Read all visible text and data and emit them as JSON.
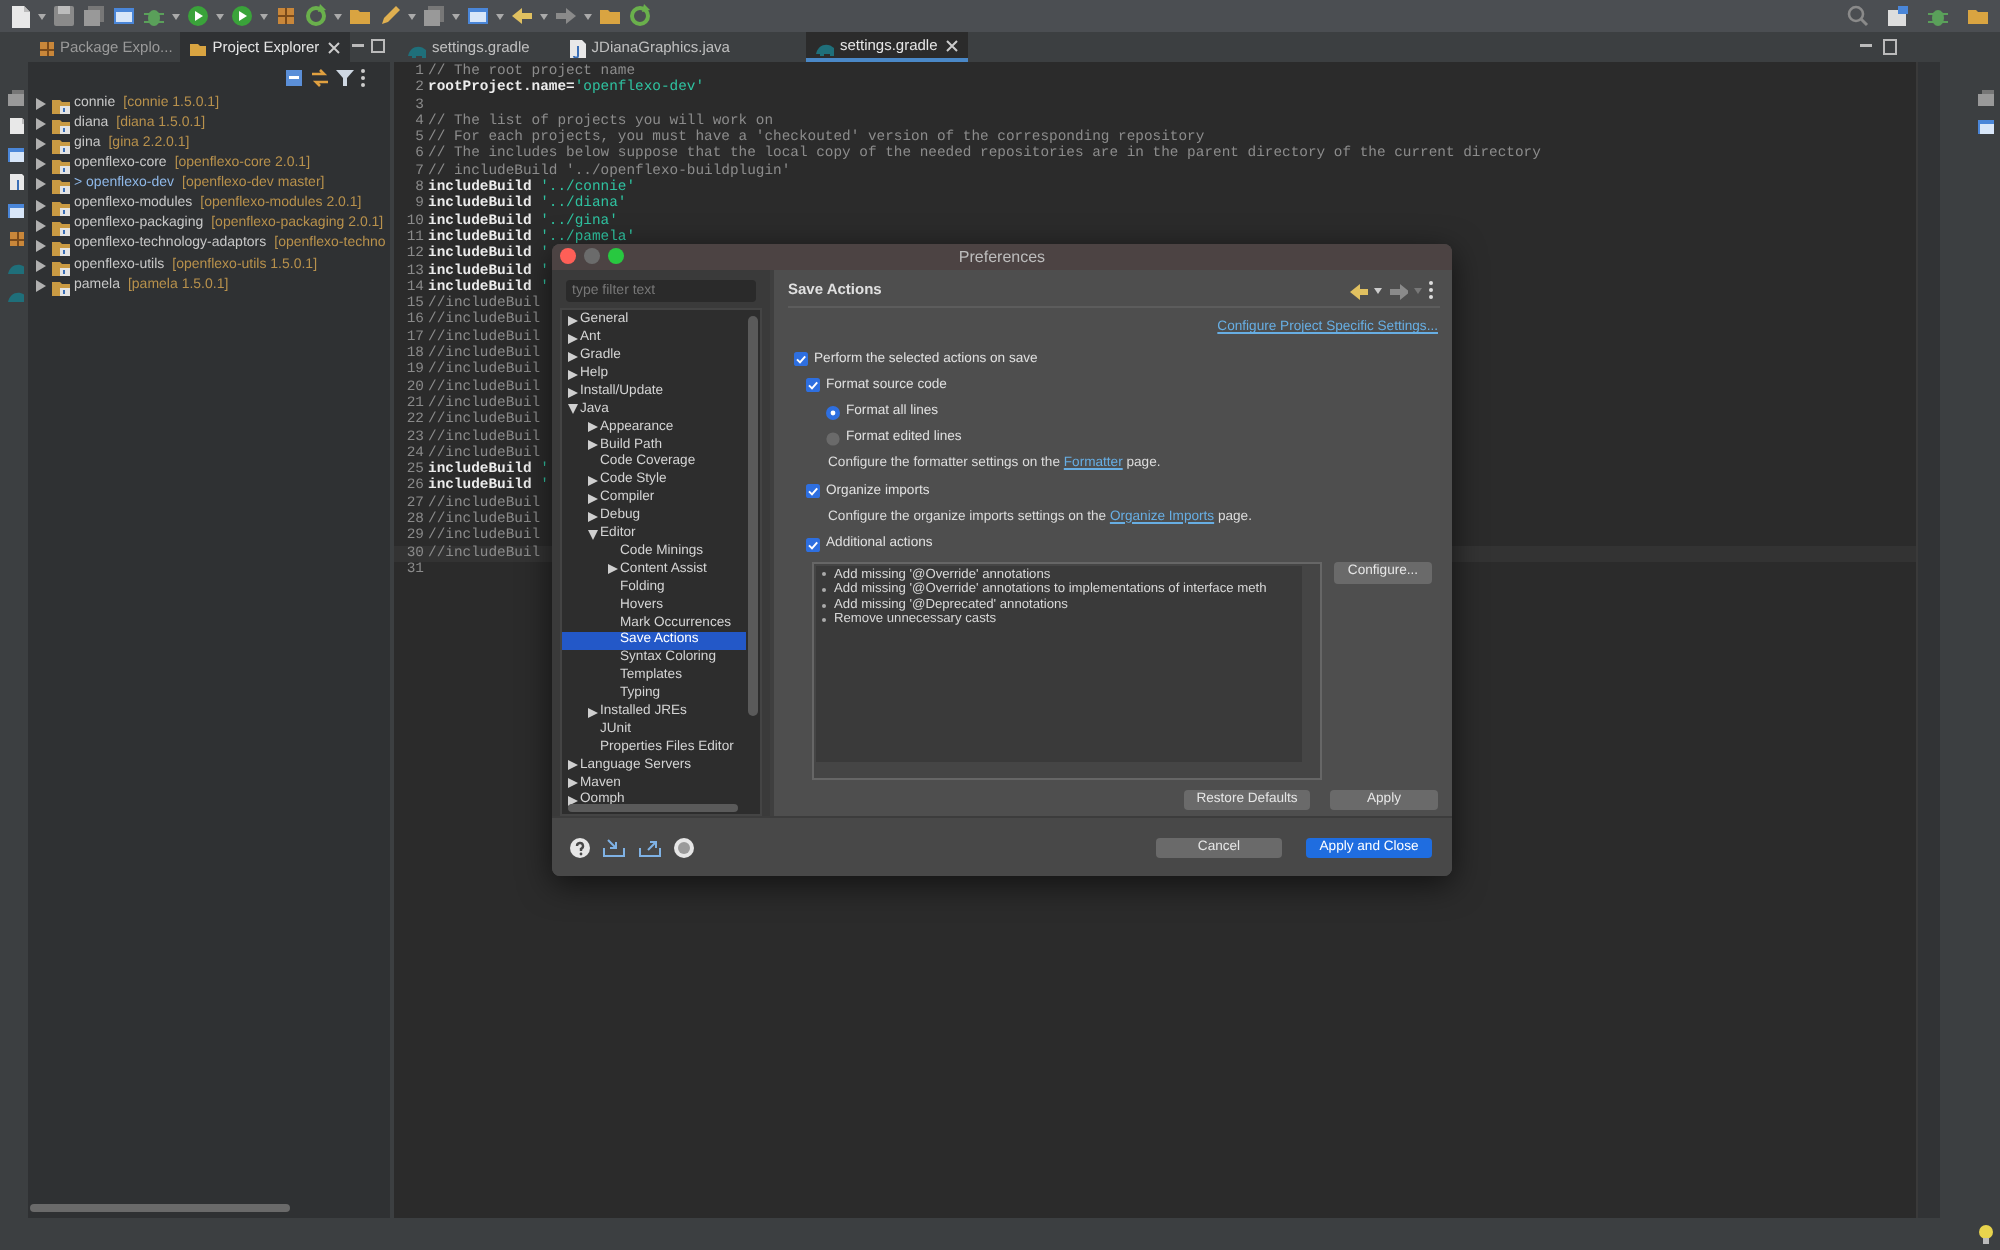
{
  "left_panel": {
    "tabs": [
      {
        "label": "Package Explo...",
        "selected": false
      },
      {
        "label": "Project Explorer",
        "selected": true
      }
    ],
    "projects": [
      {
        "name": "connie",
        "decoration": "[connie 1.5.0.1]",
        "dirty": false
      },
      {
        "name": "diana",
        "decoration": "[diana 1.5.0.1]",
        "dirty": false
      },
      {
        "name": "gina",
        "decoration": "[gina 2.2.0.1]",
        "dirty": false
      },
      {
        "name": "openflexo-core",
        "decoration": "[openflexo-core 2.0.1]",
        "dirty": false
      },
      {
        "prefix": "> ",
        "name": "openflexo-dev",
        "decoration": "[openflexo-dev master]",
        "dirty": true
      },
      {
        "name": "openflexo-modules",
        "decoration": "[openflexo-modules 2.0.1]",
        "dirty": false
      },
      {
        "name": "openflexo-packaging",
        "decoration": "[openflexo-packaging 2.0.1]",
        "dirty": false
      },
      {
        "name": "openflexo-technology-adaptors",
        "decoration": "[openflexo-techno",
        "dirty": false
      },
      {
        "name": "openflexo-utils",
        "decoration": "[openflexo-utils 1.5.0.1]",
        "dirty": false
      },
      {
        "name": "pamela",
        "decoration": "[pamela 1.5.0.1]",
        "dirty": false
      }
    ]
  },
  "editor": {
    "tabs": [
      {
        "label": "settings.gradle",
        "selected": false
      },
      {
        "label": "JDianaGraphics.java",
        "selected": false
      },
      {
        "label": "settings.gradle",
        "selected": true
      }
    ],
    "lines": [
      {
        "number": "1",
        "kind": "comment",
        "text": "// The root project name"
      },
      {
        "number": "2",
        "kind": "code",
        "code": "rootProject.name=",
        "string": "'openflexo-dev'"
      },
      {
        "number": "3",
        "kind": "blank"
      },
      {
        "number": "4",
        "kind": "comment",
        "text": "// The list of projects you will work on"
      },
      {
        "number": "5",
        "kind": "comment",
        "text": "// For each projects, you must have a 'checkouted' version of the corresponding repository"
      },
      {
        "number": "6",
        "kind": "comment",
        "text": "// The includes below suppose that the local copy of the needed repositories are in the parent directory of the current directory"
      },
      {
        "number": "7",
        "kind": "comment",
        "text": "// includeBuild '../openflexo-buildplugin'"
      },
      {
        "number": "8",
        "kind": "code",
        "code": "includeBuild ",
        "string": "'../connie'"
      },
      {
        "number": "9",
        "kind": "code",
        "code": "includeBuild ",
        "string": "'../diana'"
      },
      {
        "number": "10",
        "kind": "code",
        "code": "includeBuild ",
        "string": "'../gina'"
      },
      {
        "number": "11",
        "kind": "code",
        "code": "includeBuild ",
        "string": "'../pamela'"
      },
      {
        "number": "12",
        "kind": "code",
        "code": "includeBuild ",
        "string": "'"
      },
      {
        "number": "13",
        "kind": "code",
        "code": "includeBuild ",
        "string": "'"
      },
      {
        "number": "14",
        "kind": "code",
        "code": "includeBuild ",
        "string": "'"
      },
      {
        "number": "15",
        "kind": "comment",
        "text": "//includeBuil"
      },
      {
        "number": "16",
        "kind": "comment",
        "text": "//includeBuil"
      },
      {
        "number": "17",
        "kind": "comment",
        "text": "//includeBuil"
      },
      {
        "number": "18",
        "kind": "comment",
        "text": "//includeBuil"
      },
      {
        "number": "19",
        "kind": "comment",
        "text": "//includeBuil"
      },
      {
        "number": "20",
        "kind": "comment",
        "text": "//includeBuil"
      },
      {
        "number": "21",
        "kind": "comment",
        "text": "//includeBuil"
      },
      {
        "number": "22",
        "kind": "comment",
        "text": "//includeBuil"
      },
      {
        "number": "23",
        "kind": "comment",
        "text": "//includeBuil"
      },
      {
        "number": "24",
        "kind": "comment",
        "text": "//includeBuil"
      },
      {
        "number": "25",
        "kind": "code",
        "code": "includeBuild ",
        "string": "'"
      },
      {
        "number": "26",
        "kind": "code",
        "code": "includeBuild ",
        "string": "'"
      },
      {
        "number": "27",
        "kind": "comment",
        "text": "//includeBuil"
      },
      {
        "number": "28",
        "kind": "comment",
        "text": "//includeBuil"
      },
      {
        "number": "29",
        "kind": "comment",
        "text": "//includeBuil"
      },
      {
        "number": "30",
        "kind": "comment",
        "text": "//includeBuil"
      },
      {
        "number": "31",
        "kind": "blank"
      }
    ]
  },
  "dialog": {
    "title": "Preferences",
    "filter": {
      "placeholder": "type filter text"
    },
    "tree": [
      {
        "label": "General",
        "expanded": false,
        "selected": false
      },
      {
        "label": "Ant",
        "expanded": false,
        "selected": false
      },
      {
        "label": "Gradle",
        "expanded": false,
        "selected": false
      },
      {
        "label": "Help",
        "expanded": false,
        "selected": false
      },
      {
        "label": "Install/Update",
        "expanded": false,
        "selected": false
      },
      {
        "label": "Java",
        "expanded": true,
        "selected": false,
        "children": [
          {
            "label": "Appearance",
            "expanded": false,
            "selected": false
          },
          {
            "label": "Build Path",
            "expanded": false,
            "selected": false
          },
          {
            "label": "Code Coverage",
            "selected": false
          },
          {
            "label": "Code Style",
            "expanded": false,
            "selected": false
          },
          {
            "label": "Compiler",
            "expanded": false,
            "selected": false
          },
          {
            "label": "Debug",
            "expanded": false,
            "selected": false
          },
          {
            "label": "Editor",
            "expanded": true,
            "selected": false,
            "children": [
              {
                "label": "Code Minings",
                "selected": false
              },
              {
                "label": "Content Assist",
                "expanded": false,
                "selected": false
              },
              {
                "label": "Folding",
                "selected": false
              },
              {
                "label": "Hovers",
                "selected": false
              },
              {
                "label": "Mark Occurrences",
                "selected": false
              },
              {
                "label": "Save Actions",
                "selected": true
              },
              {
                "label": "Syntax Coloring",
                "selected": false
              },
              {
                "label": "Templates",
                "selected": false
              },
              {
                "label": "Typing",
                "selected": false
              }
            ]
          },
          {
            "label": "Installed JREs",
            "expanded": false,
            "selected": false
          },
          {
            "label": "JUnit",
            "selected": false
          },
          {
            "label": "Properties Files Editor",
            "selected": false
          }
        ]
      },
      {
        "label": "Language Servers",
        "expanded": false,
        "selected": false
      },
      {
        "label": "Maven",
        "expanded": false,
        "selected": false
      },
      {
        "label": "Oomph",
        "expanded": false,
        "selected": false
      }
    ],
    "page": {
      "title": "Save Actions",
      "link": "Configure Project Specific Settings...",
      "options": [
        {
          "kind": "checkbox",
          "label": "Perform the selected actions on save",
          "checked": true,
          "children": [
            {
              "kind": "checkbox",
              "label": "Format source code",
              "checked": true,
              "children": [
                {
                  "kind": "radio",
                  "label": "Format all lines",
                  "selected": true
                },
                {
                  "kind": "radio",
                  "label": "Format edited lines",
                  "selected": false
                },
                {
                  "kind": "note",
                  "before": "Configure the formatter settings on the ",
                  "link": "Formatter",
                  "after": " page."
                }
              ]
            },
            {
              "kind": "checkbox",
              "label": "Organize imports",
              "checked": true,
              "children": [
                {
                  "kind": "note",
                  "before": "Configure the organize imports settings on the ",
                  "link": "Organize Imports",
                  "after": " page."
                }
              ]
            },
            {
              "kind": "checkbox",
              "label": "Additional actions",
              "checked": true
            }
          ]
        }
      ],
      "actions": [
        "Add missing '@Override' annotations",
        "Add missing '@Override' annotations to implementations of interface meth",
        "Add missing '@Deprecated' annotations",
        "Remove unnecessary casts"
      ],
      "configure_button": "Configure...",
      "page_buttons": [
        {
          "label": "Restore Defaults"
        },
        {
          "label": "Apply"
        }
      ]
    },
    "buttons": [
      {
        "label": "Cancel",
        "kind": "default"
      },
      {
        "label": "Apply and Close",
        "kind": "primary"
      }
    ]
  }
}
